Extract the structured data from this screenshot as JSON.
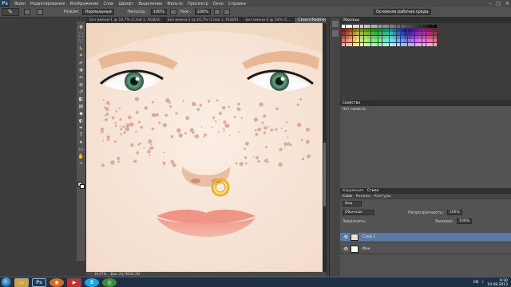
{
  "app": {
    "logo": "Ps"
  },
  "menu": [
    "Файл",
    "Редактирование",
    "Изображение",
    "Слои",
    "Шрифт",
    "Выделение",
    "Фильтр",
    "Просмотр",
    "Окно",
    "Справка"
  ],
  "options": {
    "mode_label": "Режим:",
    "mode_value": "Нормальный",
    "opacity_label": "Непрозр.:",
    "opacity_value": "100%",
    "flow_label": "Наж.:",
    "flow_value": "100%",
    "workspace": "Основная рабочая среда"
  },
  "doc_tabs": [
    {
      "label": "Без имени-1 @ 16,7% (Слой 1, RGB/8)"
    },
    {
      "label": "Без имени-2 @ 16,7% (Слой 1, RGB/8)"
    },
    {
      "label": "Без имени-3 @ 50% (С..."
    },
    {
      "label": "Cheers!Redmond.psd @ 16,7% (Слой 1, RGB/8)"
    }
  ],
  "status": {
    "zoom": "16,67%",
    "doc": "Док: 24,7M/36,7M"
  },
  "panels": {
    "swatches_tabs": [
      "Образцы"
    ],
    "props_title": "Свойства",
    "props_text": "Нет свойств",
    "layers_tabs": [
      "Коррекция",
      "Стили"
    ],
    "layers_subtabs": [
      "Слои",
      "Каналы",
      "Контуры"
    ],
    "kind": "Вид",
    "blend": "Обычные",
    "opacity_label": "Непрозрачность:",
    "opacity_value": "100%",
    "lock_label": "Закрепить:",
    "fill_label": "Заливка:",
    "fill_value": "100%",
    "layers": [
      {
        "name": "Слой 1",
        "selected": true
      },
      {
        "name": "Фон",
        "selected": false
      }
    ]
  },
  "taskbar": {
    "lang": "EN",
    "time": "9:30",
    "date": "10.08.2013"
  },
  "colors": {
    "skin": "#f8e6d8",
    "hair": "#e8c7a2",
    "brow": "#d9a98a",
    "freckle": "#d69b83",
    "lips": "#f0a296",
    "iris": "#4f8a6d",
    "brush": "#f2b21b"
  }
}
